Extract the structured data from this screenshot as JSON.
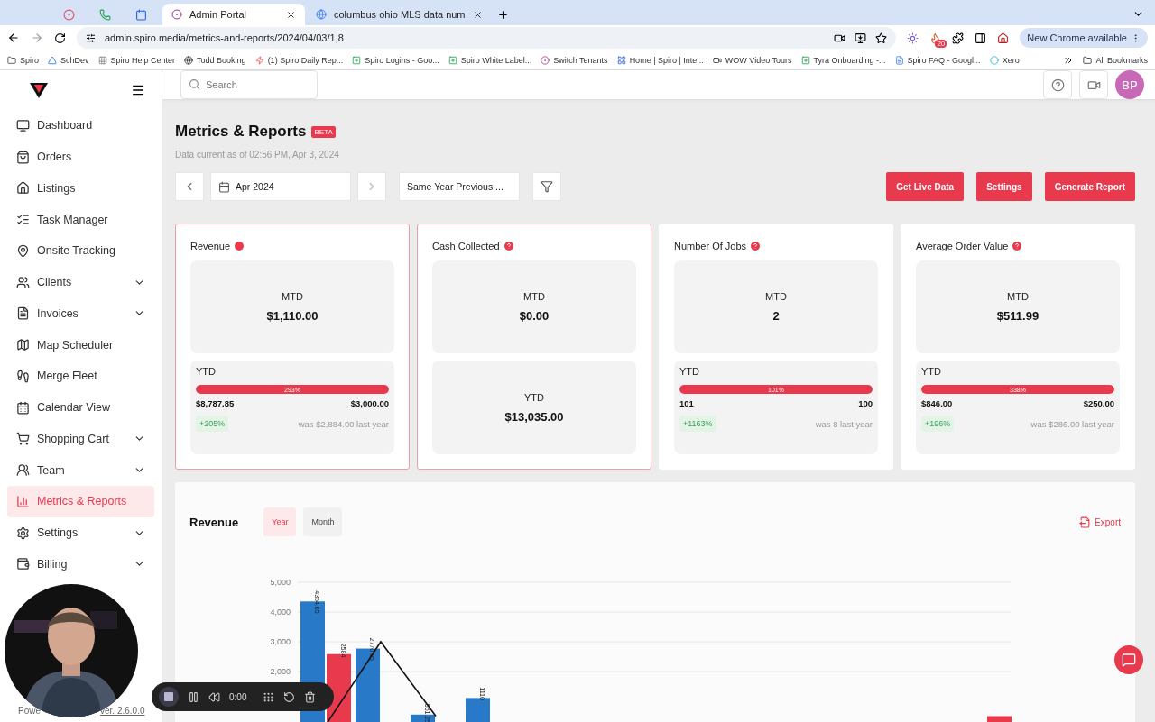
{
  "browser": {
    "tabs": [
      {
        "kind": "icon",
        "selected": false
      },
      {
        "kind": "icon",
        "selected": false
      },
      {
        "kind": "icon",
        "selected": false
      },
      {
        "kind": "page",
        "title": "Admin Portal",
        "selected": true
      },
      {
        "kind": "page",
        "title": "columbus ohio MLS data num",
        "selected": false
      }
    ],
    "url": "admin.spiro.media/metrics-and-reports/2024/04/03/1,8",
    "extension_badge": "20",
    "update_button": "New Chrome available",
    "bookmarks": [
      "Spiro",
      "SchDev",
      "Spiro Help Center",
      "Todd Booking",
      "(1) Spiro Daily Rep...",
      "Spiro Logins - Goo...",
      "Spiro White Label...",
      "Switch Tenants",
      "Home | Spiro | Inte...",
      "WOW Video Tours",
      "Tyra Onboarding -...",
      "Spiro FAQ - Googl...",
      "Xero"
    ],
    "all_bookmarks": "All Bookmarks"
  },
  "topbar": {
    "search": {
      "placeholder": "Search"
    },
    "avatar": "BP"
  },
  "sidebar": {
    "items": [
      {
        "label": "Dashboard",
        "selected": false,
        "expandable": false
      },
      {
        "label": "Orders",
        "selected": false,
        "expandable": false
      },
      {
        "label": "Listings",
        "selected": false,
        "expandable": false
      },
      {
        "label": "Task Manager",
        "selected": false,
        "expandable": false
      },
      {
        "label": "Onsite Tracking",
        "selected": false,
        "expandable": false
      },
      {
        "label": "Clients",
        "selected": false,
        "expandable": true
      },
      {
        "label": "Invoices",
        "selected": false,
        "expandable": true
      },
      {
        "label": "Map Scheduler",
        "selected": false,
        "expandable": false
      },
      {
        "label": "Merge Fleet",
        "selected": false,
        "expandable": false
      },
      {
        "label": "Calendar View",
        "selected": false,
        "expandable": false
      },
      {
        "label": "Shopping Cart",
        "selected": false,
        "expandable": true
      },
      {
        "label": "Team",
        "selected": false,
        "expandable": true
      },
      {
        "label": "Metrics & Reports",
        "selected": true,
        "expandable": false
      },
      {
        "label": "Settings",
        "selected": false,
        "expandable": true
      },
      {
        "label": "Billing",
        "selected": false,
        "expandable": true
      }
    ],
    "footer": {
      "powered": "Powe",
      "version": "ver. 2.6.0.0"
    }
  },
  "page": {
    "title": "Metrics & Reports",
    "badge": "BETA",
    "subtitle": "Data current as of 02:56 PM, Apr 3, 2024",
    "period": "Apr 2024",
    "compare": "Same Year Previous ...",
    "buttons": [
      "Get Live Data",
      "Settings",
      "Generate Report"
    ],
    "cards": [
      {
        "title": "Revenue",
        "kind": "dot",
        "highlighted": true,
        "mtd_label": "MTD",
        "mtd_value": "$1,110.00",
        "ytd": {
          "kind": "progress",
          "label": "YTD",
          "percent": "293%",
          "level": 1,
          "actual": "$8,787.85",
          "goal": "$3,000.00",
          "change": "+205%",
          "previous": "was $2,884.00 last year"
        }
      },
      {
        "title": "Cash Collected",
        "kind": "question",
        "highlighted": true,
        "mtd_label": "MTD",
        "mtd_value": "$0.00",
        "ytd": {
          "kind": "value",
          "label": "YTD",
          "value": "$13,035.00"
        }
      },
      {
        "title": "Number Of Jobs",
        "kind": "question",
        "highlighted": false,
        "mtd_label": "MTD",
        "mtd_value": "2",
        "ytd": {
          "kind": "progress",
          "label": "YTD",
          "percent": "101%",
          "level": 1,
          "actual": "101",
          "goal": "100",
          "change": "+1163%",
          "previous": "was 8 last year"
        }
      },
      {
        "title": "Average Order Value",
        "kind": "question",
        "highlighted": false,
        "mtd_label": "MTD",
        "mtd_value": "$511.99",
        "ytd": {
          "kind": "progress",
          "label": "YTD",
          "percent": "338%",
          "level": 1,
          "actual": "$846.00",
          "goal": "$250.00",
          "change": "+196%",
          "previous": "was $286.00 last year"
        }
      }
    ],
    "chart_section": {
      "title": "Revenue",
      "tabs": [
        {
          "label": "Year",
          "selected": true
        },
        {
          "label": "Month",
          "selected": false
        }
      ],
      "export": "Export",
      "chart_data": {
        "type": "bar",
        "grid": true,
        "yticks": [
          {
            "value": 2000,
            "label": "2,000"
          },
          {
            "value": 3000,
            "label": "3,000"
          },
          {
            "value": 4000,
            "label": "4,000"
          },
          {
            "value": 5000,
            "label": "5,000"
          }
        ],
        "ylim": [
          0,
          5000
        ],
        "series": [
          {
            "color": "#2979c9",
            "values": [
              4354.65,
              2770.95,
              551.25,
              1110,
              null,
              null,
              null,
              null,
              null,
              null,
              null,
              null,
              null
            ],
            "value_labels": [
              "4354.65",
              "2770.95",
              "551.25",
              "1110",
              null,
              null,
              null,
              null,
              null,
              null,
              null,
              null,
              null
            ]
          },
          {
            "color": "#e8394d",
            "values": [
              2584,
              null,
              0,
              null,
              null,
              null,
              null,
              null,
              null,
              null,
              null,
              null,
              500
            ],
            "value_labels": [
              "2584",
              null,
              null,
              null,
              null,
              null,
              null,
              null,
              null,
              null,
              null,
              null,
              null
            ]
          },
          {
            "type": "line",
            "color": "#111111",
            "values": [
              200,
              3000,
              500,
              null,
              null,
              null,
              null,
              null,
              null,
              null,
              null,
              null,
              null
            ]
          }
        ]
      }
    },
    "recorder": {
      "time": "0:00"
    }
  }
}
